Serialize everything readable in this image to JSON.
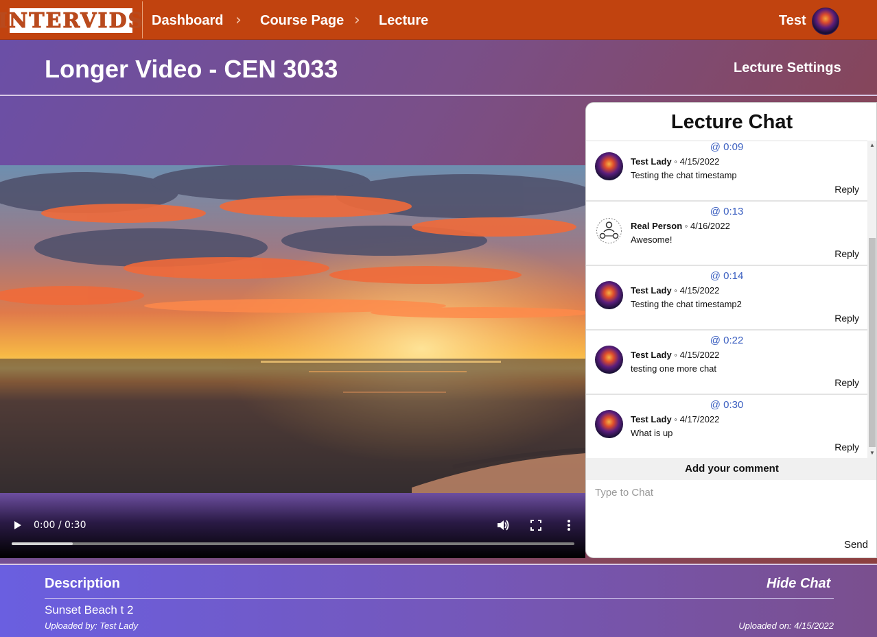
{
  "nav": {
    "logo_text": "INTERVIDS",
    "breadcrumbs": [
      "Dashboard",
      "Course Page",
      "Lecture"
    ],
    "user_name": "Test"
  },
  "header": {
    "title": "Longer Video - CEN 3033",
    "settings_label": "Lecture Settings"
  },
  "video": {
    "time": "0:00 / 0:30",
    "progress_fraction": 0.108
  },
  "chat": {
    "title": "Lecture Chat",
    "messages": [
      {
        "timestamp": "@ 0:09",
        "author": "Test Lady",
        "date": "4/15/2022",
        "text": "Testing the chat timestamp",
        "reply": "Reply"
      },
      {
        "timestamp": "@ 0:13",
        "author": "Real Person",
        "date": "4/16/2022",
        "text": "Awesome!",
        "reply": "Reply"
      },
      {
        "timestamp": "@ 0:14",
        "author": "Test Lady",
        "date": "4/15/2022",
        "text": "Testing the chat timestamp2",
        "reply": "Reply"
      },
      {
        "timestamp": "@ 0:22",
        "author": "Test Lady",
        "date": "4/15/2022",
        "text": "testing one more chat",
        "reply": "Reply"
      },
      {
        "timestamp": "@ 0:30",
        "author": "Test Lady",
        "date": "4/17/2022",
        "text": "What is up",
        "reply": "Reply"
      }
    ],
    "add_comment_label": "Add your comment",
    "input_placeholder": "Type to Chat",
    "send_label": "Send"
  },
  "description": {
    "label": "Description",
    "hide_chat_label": "Hide Chat",
    "text": "Sunset Beach t 2",
    "uploaded_by": "Uploaded by: Test Lady",
    "uploaded_on": "Uploaded on: 4/15/2022"
  },
  "colors": {
    "nav_bg": "#c1430f",
    "timestamp": "#3b5fc0"
  }
}
